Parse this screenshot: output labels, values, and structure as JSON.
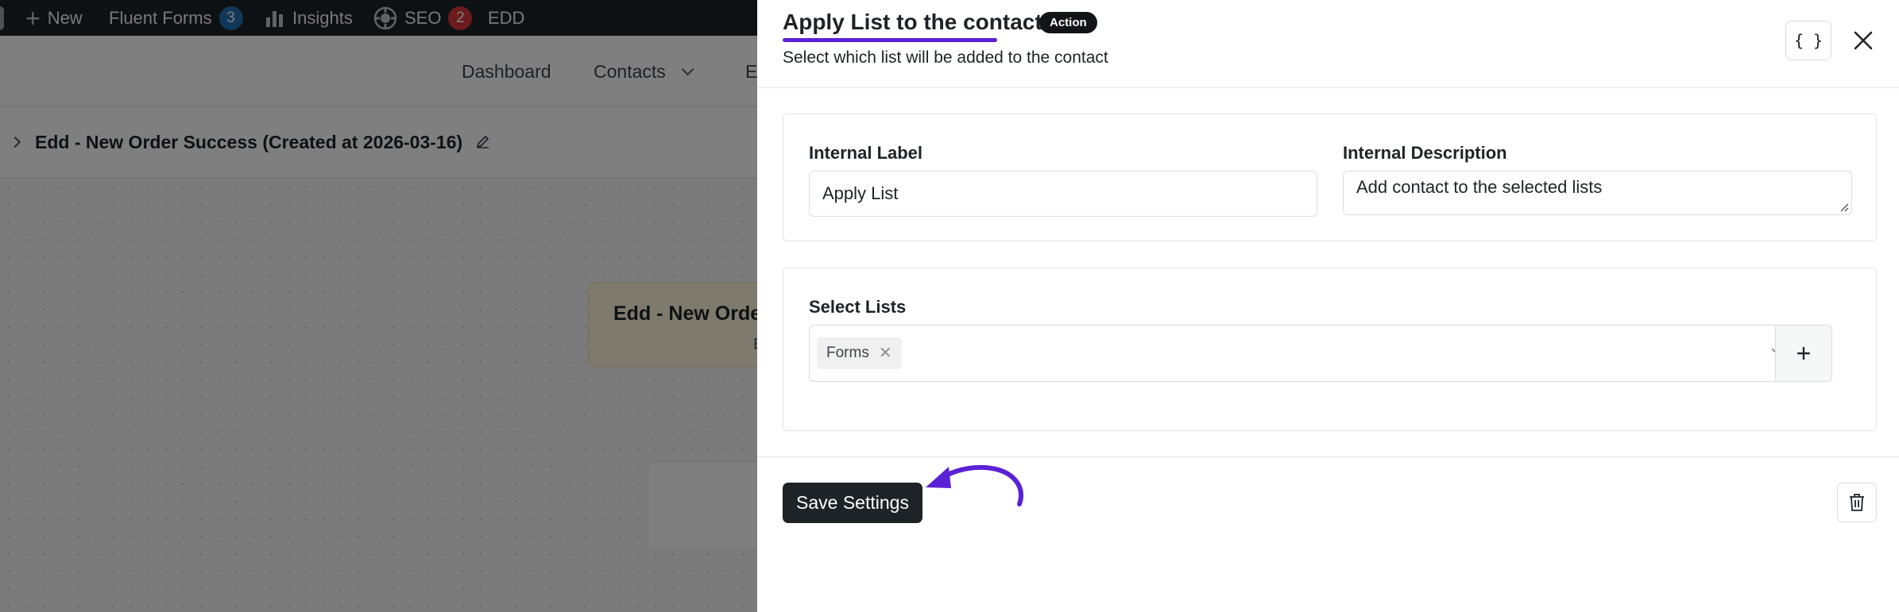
{
  "admin_bar": {
    "new_label": "New",
    "fluent_forms_label": "Fluent Forms",
    "fluent_forms_count": "3",
    "insights_label": "Insights",
    "seo_label": "SEO",
    "seo_count": "2",
    "edd_label": "EDD"
  },
  "app_nav": {
    "items": [
      {
        "label": "Dashboard"
      },
      {
        "label": "Contacts"
      },
      {
        "label": "E"
      }
    ]
  },
  "funnel": {
    "title": "Edd - New Order Success (Created at 2026-03-16)",
    "trigger_title": "Edd - New Orde",
    "trigger_sub": "E"
  },
  "drawer": {
    "title": "Apply List to the contact",
    "tag": "Action",
    "description": "Select which list will be added to the contact",
    "code_button": "{ }",
    "internal_label": {
      "label": "Internal Label",
      "value": "Apply List"
    },
    "internal_description": {
      "label": "Internal Description",
      "value": "Add contact to the selected lists"
    },
    "select_lists": {
      "label": "Select Lists",
      "selected": [
        "Forms"
      ],
      "add_button": "+"
    },
    "save_button": "Save Settings"
  },
  "colors": {
    "accent_annotation": "#5b21d6",
    "dark_button": "#1d2327",
    "badge_blue": "#2271b1",
    "badge_red": "#d63638"
  },
  "icons": [
    "plus-icon",
    "insights-bars-icon",
    "seo-gear-icon",
    "chevron-down-icon",
    "chevron-right-icon",
    "pencil-icon",
    "close-icon",
    "remove-chip-icon",
    "trash-icon",
    "annotation-arrow"
  ]
}
